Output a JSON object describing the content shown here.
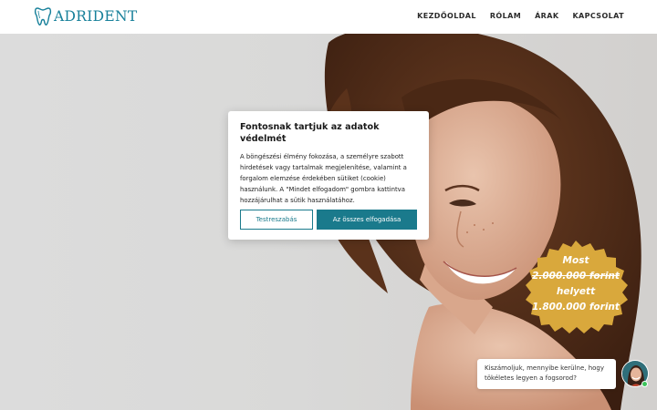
{
  "brand": {
    "name": "ADRIDENT",
    "logo_icon": "tooth-icon",
    "color": "#17809a"
  },
  "nav": {
    "items": [
      {
        "label": "KEZDŐOLDAL"
      },
      {
        "label": "RÓLAM"
      },
      {
        "label": "ÁRAK"
      },
      {
        "label": "KAPCSOLAT"
      }
    ]
  },
  "cookie": {
    "title": "Fontosnak tartjuk az adatok védelmét",
    "text": "A böngészési élmény fokozása, a személyre szabott hirdetések vagy tartalmak megjelenítése, valamint a forgalom elemzése érdekében sütiket (cookie) használunk. A \"Mindet elfogadom\" gombra kattintva hozzájárulhat a sütik használatához.",
    "customize_label": "Testreszabás",
    "accept_label": "Az összes elfogadása",
    "accent": "#1a7a8c"
  },
  "badge": {
    "line1": "Most",
    "old_price": "2.000.000 forint",
    "line3": "helyett",
    "new_price": "1.800.000 forint",
    "color": "#d9a83c"
  },
  "chat": {
    "message": "Kiszámoljuk, mennyibe kerülne, hogy tökéletes legyen a fogsorod?",
    "status_color": "#3cc35a"
  }
}
